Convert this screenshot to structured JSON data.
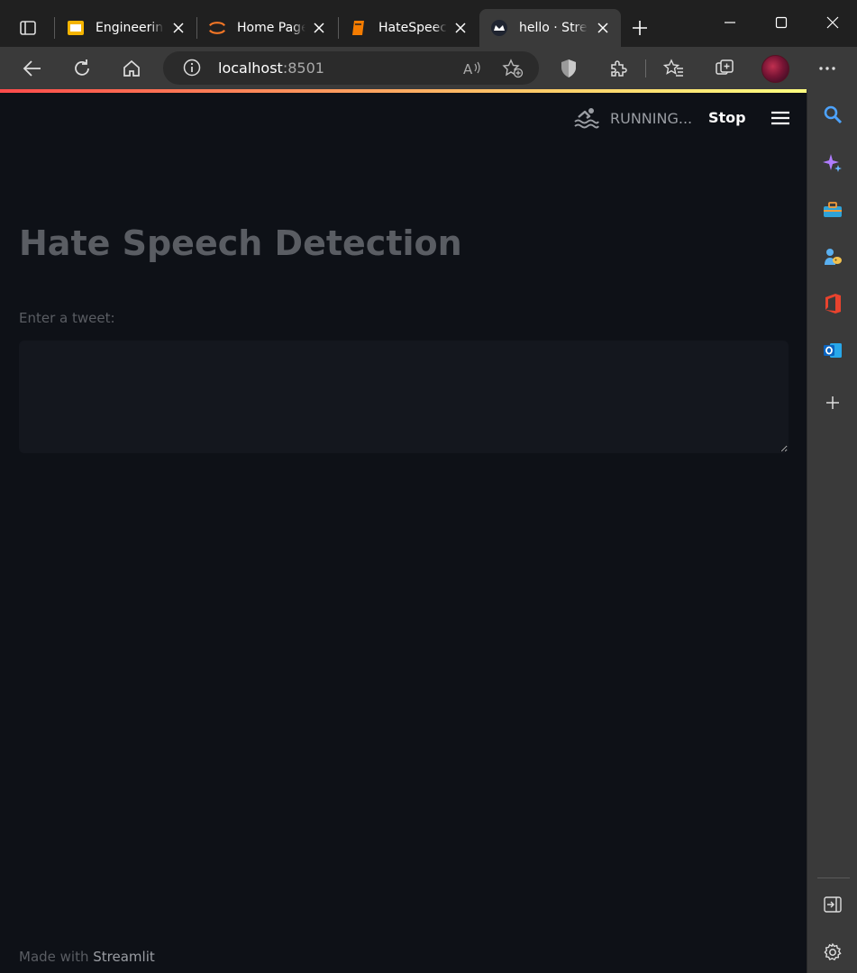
{
  "browser": {
    "tabs": [
      {
        "title": "Engineering",
        "favicon": "slides-icon",
        "active": false
      },
      {
        "title": "Home Page",
        "favicon": "jupyter-icon",
        "active": false
      },
      {
        "title": "HateSpeech",
        "favicon": "notebook-icon",
        "active": false
      },
      {
        "title": "hello · Streamlit",
        "favicon": "streamlit-icon",
        "active": true
      }
    ],
    "url": {
      "host": "localhost",
      "port": ":8501"
    },
    "colors": {
      "chrome": "#202020",
      "toolbar": "#3a3a3a",
      "accent_gradient_start": "#ff4b4b",
      "accent_gradient_end": "#fffd80"
    }
  },
  "app": {
    "status": "RUNNING...",
    "stop_label": "Stop",
    "title": "Hate Speech Detection",
    "input_label": "Enter a tweet:",
    "input_value": "",
    "footer_prefix": "Made with ",
    "footer_link": "Streamlit",
    "colors": {
      "background": "#0e1117",
      "input_bg": "#14171e",
      "muted_text": "#5a5d63"
    }
  },
  "sidebar": {
    "items": [
      "search-icon",
      "copilot-icon",
      "tools-icon",
      "games-icon",
      "office-icon",
      "outlook-icon",
      "add-icon"
    ],
    "bottom": [
      "split-screen-icon",
      "settings-icon"
    ]
  }
}
